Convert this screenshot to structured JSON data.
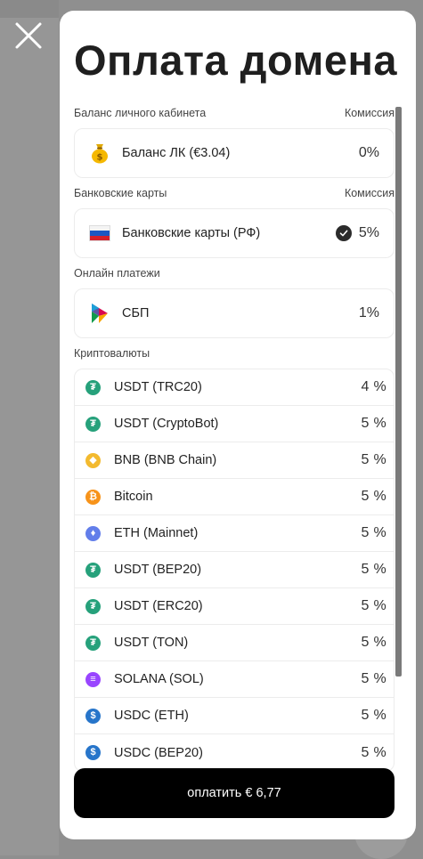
{
  "title": "Оплата домена",
  "sections": {
    "balance": {
      "label": "Баланс личного кабинета",
      "commission_label": "Комиссия",
      "item": {
        "label": "Баланс ЛК (€3.04)",
        "fee": "0%",
        "icon": "money-bag-icon"
      }
    },
    "cards": {
      "label": "Банковские карты",
      "commission_label": "Комиссия",
      "item": {
        "label": "Банковские карты (РФ)",
        "fee": "5%",
        "icon": "russia-flag-icon",
        "selected": true
      }
    },
    "online": {
      "label": "Онлайн платежи",
      "item": {
        "label": "СБП",
        "fee": "1%",
        "icon": "sbp-icon"
      }
    },
    "crypto": {
      "label": "Криптовалюты",
      "items": [
        {
          "label": "USDT (TRC20)",
          "fee": "4 %",
          "icon": "tether-icon",
          "color": "#26a17b",
          "glyph": "₮"
        },
        {
          "label": "USDT (CryptoBot)",
          "fee": "5 %",
          "icon": "tether-icon",
          "color": "#26a17b",
          "glyph": "₮"
        },
        {
          "label": "BNB (BNB Chain)",
          "fee": "5 %",
          "icon": "bnb-icon",
          "color": "#f3ba2f",
          "glyph": "◆"
        },
        {
          "label": "Bitcoin",
          "fee": "5 %",
          "icon": "bitcoin-icon",
          "color": "#f7931a",
          "glyph": "₿"
        },
        {
          "label": "ETH (Mainnet)",
          "fee": "5 %",
          "icon": "ethereum-icon",
          "color": "#627eea",
          "glyph": "♦"
        },
        {
          "label": "USDT (BEP20)",
          "fee": "5 %",
          "icon": "tether-icon",
          "color": "#26a17b",
          "glyph": "₮"
        },
        {
          "label": "USDT (ERC20)",
          "fee": "5 %",
          "icon": "tether-icon",
          "color": "#26a17b",
          "glyph": "₮"
        },
        {
          "label": "USDT (TON)",
          "fee": "5 %",
          "icon": "tether-icon",
          "color": "#26a17b",
          "glyph": "₮"
        },
        {
          "label": "SOLANA (SOL)",
          "fee": "5 %",
          "icon": "solana-icon",
          "color": "#9945ff",
          "glyph": "≡"
        },
        {
          "label": "USDC (ETH)",
          "fee": "5 %",
          "icon": "usdc-icon",
          "color": "#2775ca",
          "glyph": "$"
        },
        {
          "label": "USDC (BEP20)",
          "fee": "5 %",
          "icon": "usdc-icon",
          "color": "#2775ca",
          "glyph": "$"
        }
      ]
    }
  },
  "pay_button": {
    "label": "оплатить € 6,77"
  },
  "close_icon": "close-icon",
  "colors": {
    "accent": "#000000",
    "tether": "#26a17b",
    "overlay": "#8f8f8f"
  }
}
